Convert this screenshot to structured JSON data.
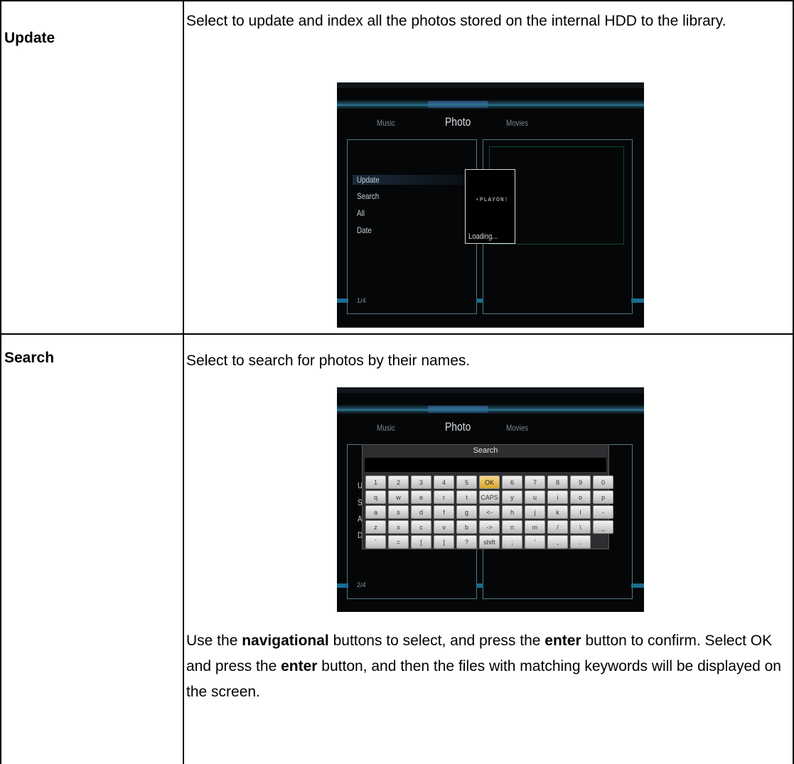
{
  "rows": [
    {
      "term": "Update",
      "description": "Select to update and index all the photos stored on the internal HDD to the library.",
      "screenshot": {
        "tabs": [
          "Music",
          "Photo",
          "Movies"
        ],
        "menu": [
          "Update",
          "Search",
          "All",
          "Date"
        ],
        "page": "1/4",
        "dialog_logo": "PLAYON!",
        "dialog_text": "Loading..."
      }
    },
    {
      "term": "Search",
      "description": "Select to search for photos by their names.",
      "screenshot": {
        "tabs": [
          "Music",
          "Photo",
          "Movies"
        ],
        "menu_letters": [
          "U",
          "S",
          "A",
          "D"
        ],
        "page": "2/4",
        "keyboard_title": "Search",
        "keyboard_rows": [
          [
            "1",
            "2",
            "3",
            "4",
            "5",
            "OK",
            "6",
            "7",
            "8",
            "9",
            "0"
          ],
          [
            "q",
            "w",
            "e",
            "r",
            "t",
            "CAPS",
            "y",
            "u",
            "i",
            "o",
            "p"
          ],
          [
            "a",
            "s",
            "d",
            "f",
            "g",
            "<-",
            "h",
            "j",
            "k",
            "l",
            "-"
          ],
          [
            "z",
            "x",
            "c",
            "v",
            "b",
            "->",
            "n",
            "m",
            "/",
            "\\",
            "_"
          ],
          [
            "`",
            "=",
            "[",
            "]",
            "?",
            "shift",
            ";",
            "'",
            ",",
            "."
          ]
        ],
        "selected_key": "OK"
      },
      "instructions": {
        "p1": "Use the ",
        "b1": "navigational",
        "p2": " buttons to select, and press the ",
        "b2": "enter",
        "p3": " button to confirm. Select OK and press the ",
        "b3": "enter",
        "p4": " button, and then the files with matching keywords will be displayed on the screen."
      }
    }
  ]
}
